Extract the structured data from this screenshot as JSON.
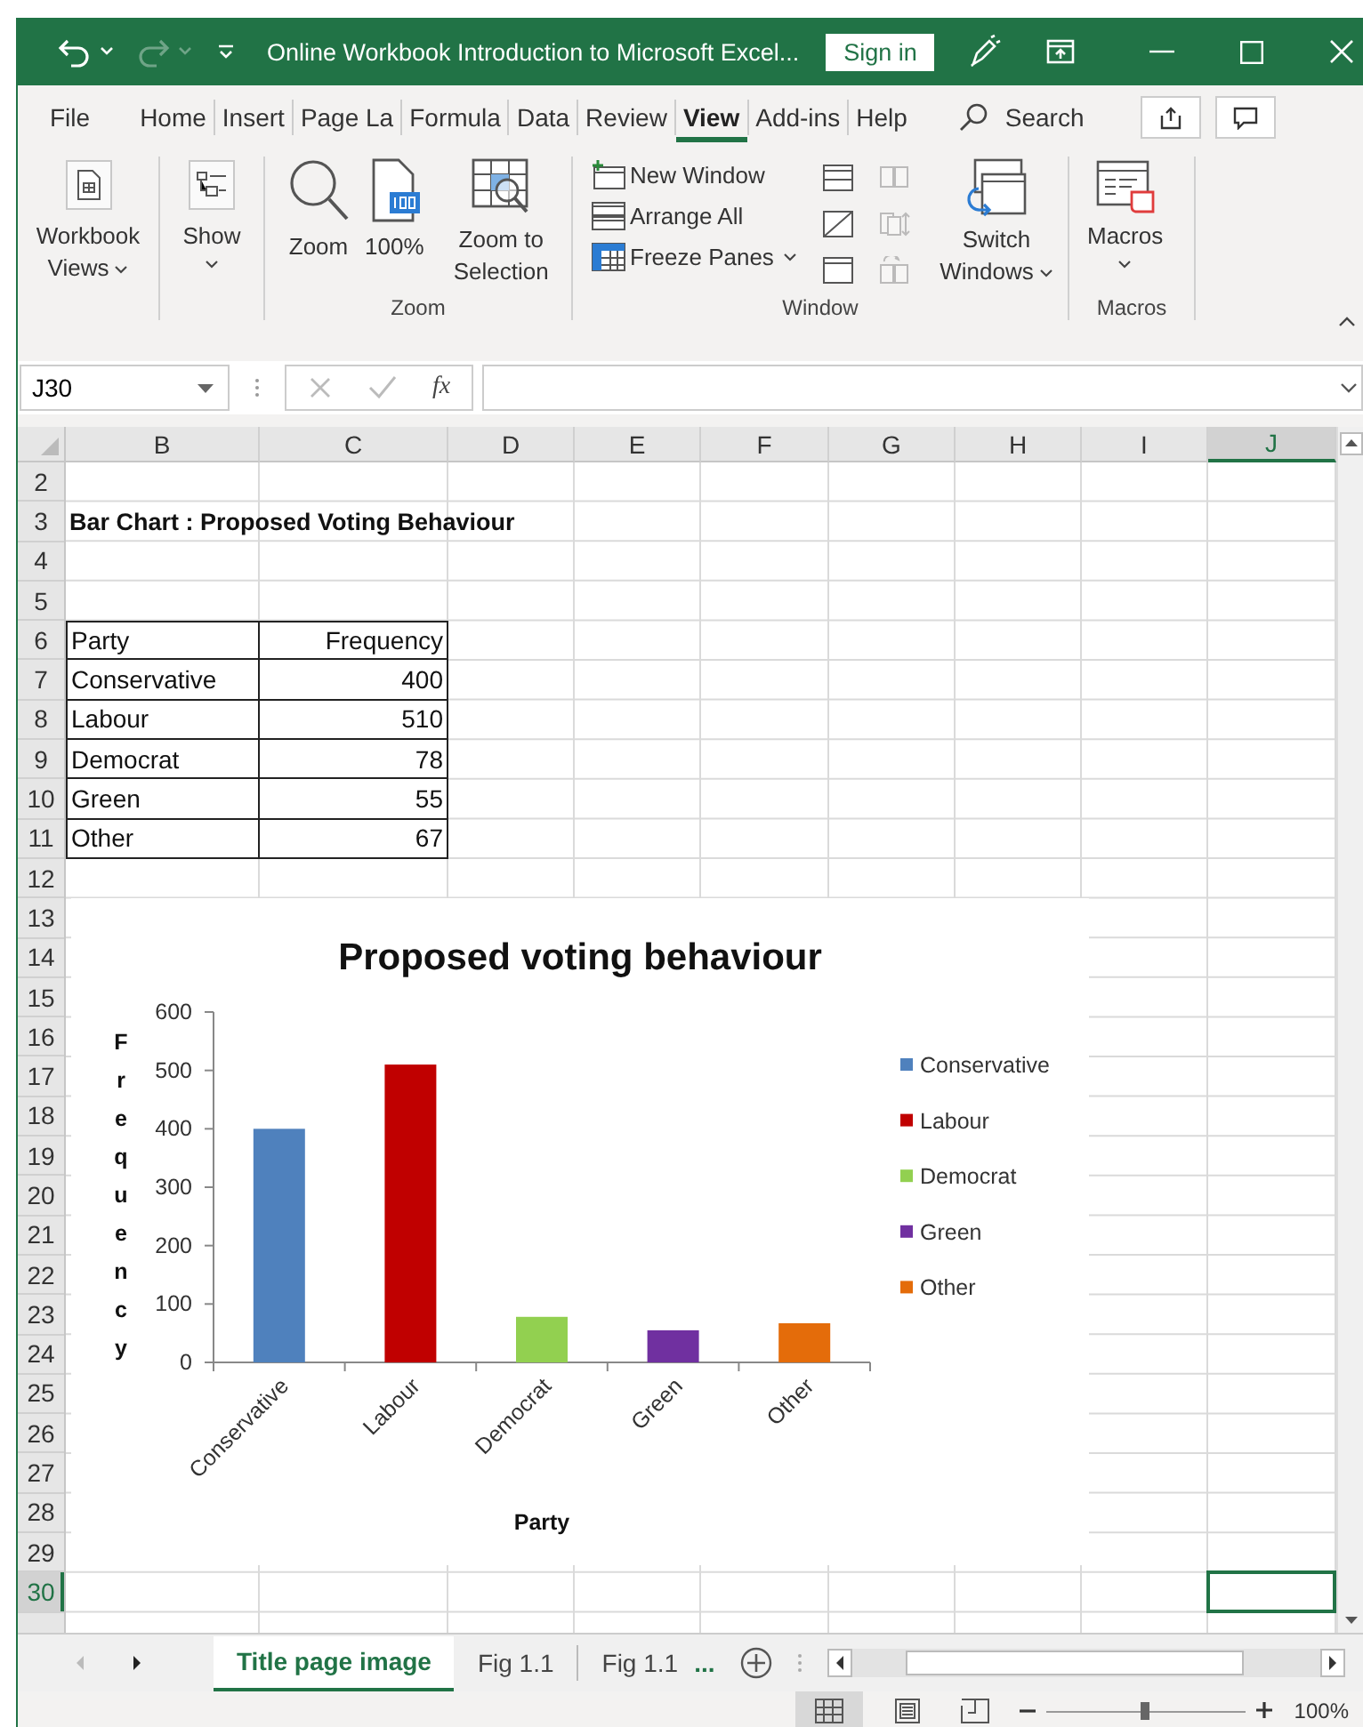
{
  "title_bar": {
    "title": "Online Workbook Introduction to Microsoft Excel...",
    "sign_in": "Sign in",
    "redo": {
      "disabled": true
    }
  },
  "menu": {
    "tabs": [
      {
        "label": "File",
        "selected": false
      },
      {
        "label": "Home",
        "selected": false
      },
      {
        "label": "Insert",
        "selected": false
      },
      {
        "label": "Page La",
        "selected": false
      },
      {
        "label": "Formula",
        "selected": false
      },
      {
        "label": "Data",
        "selected": false
      },
      {
        "label": "Review",
        "selected": false
      },
      {
        "label": "View",
        "selected": true
      },
      {
        "label": "Add-ins",
        "selected": false
      },
      {
        "label": "Help",
        "selected": false
      }
    ],
    "search": "Search"
  },
  "ribbon": {
    "workbook_views": "Workbook Views",
    "show": "Show",
    "zoom_group": {
      "label": "Zoom",
      "buttons": [
        "Zoom",
        "100%",
        "Zoom to Selection"
      ]
    },
    "window_group": {
      "label": "Window",
      "commands": [
        "New Window",
        "Arrange All",
        "Freeze Panes"
      ],
      "view_buttons": [
        {
          "disabled": false
        },
        {
          "disabled": false
        },
        {
          "disabled": false
        },
        {
          "disabled": true
        },
        {
          "disabled": true
        },
        {
          "disabled": true
        }
      ],
      "switch_windows": "Switch Windows"
    },
    "macros_group": {
      "label": "Macros",
      "button": "Macros"
    }
  },
  "formula_bar": {
    "name_box": "J30",
    "function_symbol": "fx"
  },
  "sheet": {
    "columns": [
      {
        "label": "B",
        "selected": false
      },
      {
        "label": "C",
        "selected": false
      },
      {
        "label": "D",
        "selected": false
      },
      {
        "label": "E",
        "selected": false
      },
      {
        "label": "F",
        "selected": false
      },
      {
        "label": "G",
        "selected": false
      },
      {
        "label": "H",
        "selected": false
      },
      {
        "label": "I",
        "selected": false
      },
      {
        "label": "J",
        "selected": true
      }
    ],
    "rows": [
      {
        "label": "2",
        "selected": false
      },
      {
        "label": "3",
        "selected": false
      },
      {
        "label": "4",
        "selected": false
      },
      {
        "label": "5",
        "selected": false
      },
      {
        "label": "6",
        "selected": false
      },
      {
        "label": "7",
        "selected": false
      },
      {
        "label": "8",
        "selected": false
      },
      {
        "label": "9",
        "selected": false
      },
      {
        "label": "10",
        "selected": false
      },
      {
        "label": "11",
        "selected": false
      },
      {
        "label": "12",
        "selected": false
      },
      {
        "label": "13",
        "selected": false
      },
      {
        "label": "14",
        "selected": false
      },
      {
        "label": "15",
        "selected": false
      },
      {
        "label": "16",
        "selected": false
      },
      {
        "label": "17",
        "selected": false
      },
      {
        "label": "18",
        "selected": false
      },
      {
        "label": "19",
        "selected": false
      },
      {
        "label": "20",
        "selected": false
      },
      {
        "label": "21",
        "selected": false
      },
      {
        "label": "22",
        "selected": false
      },
      {
        "label": "23",
        "selected": false
      },
      {
        "label": "24",
        "selected": false
      },
      {
        "label": "25",
        "selected": false
      },
      {
        "label": "26",
        "selected": false
      },
      {
        "label": "27",
        "selected": false
      },
      {
        "label": "28",
        "selected": false
      },
      {
        "label": "29",
        "selected": false
      },
      {
        "label": "30",
        "selected": true
      }
    ],
    "sheet_title": "Bar Chart : Proposed Voting Behaviour",
    "data_table": {
      "header": [
        "Party",
        "Frequency"
      ],
      "rows": [
        [
          "Conservative",
          "400"
        ],
        [
          "Labour",
          "510"
        ],
        [
          "Democrat",
          "78"
        ],
        [
          "Green",
          "55"
        ],
        [
          "Other",
          "67"
        ]
      ]
    },
    "chart": {
      "chart_data": {
        "type": "bar",
        "title": "Proposed voting behaviour",
        "xlabel": "Party",
        "ylabel": "Frequency",
        "categories": [
          "Conservative",
          "Labour",
          "Democrat",
          "Green",
          "Other"
        ],
        "values": [
          400,
          510,
          78,
          55,
          67
        ],
        "ylim": [
          0,
          600
        ],
        "yticks": [
          0,
          100,
          200,
          300,
          400,
          500,
          600
        ]
      },
      "legend": [
        {
          "label": "Conservative",
          "color": "#4f81bd"
        },
        {
          "label": "Labour",
          "color": "#c00000"
        },
        {
          "label": "Democrat",
          "color": "#92d050"
        },
        {
          "label": "Green",
          "color": "#7030a0"
        },
        {
          "label": "Other",
          "color": "#e46c0a"
        }
      ]
    }
  },
  "sheet_tabs": {
    "tabs": [
      {
        "label": "Title page image",
        "selected": true
      },
      {
        "label": "Fig 1.1",
        "selected": false
      },
      {
        "label": "Fig 1.1",
        "selected": false
      }
    ],
    "more": "..."
  },
  "status_bar": {
    "views": [
      {
        "selected": true
      },
      {
        "selected": false
      },
      {
        "selected": false
      }
    ],
    "zoom_slider": {
      "level": 0.5
    },
    "zoom": "100%"
  }
}
